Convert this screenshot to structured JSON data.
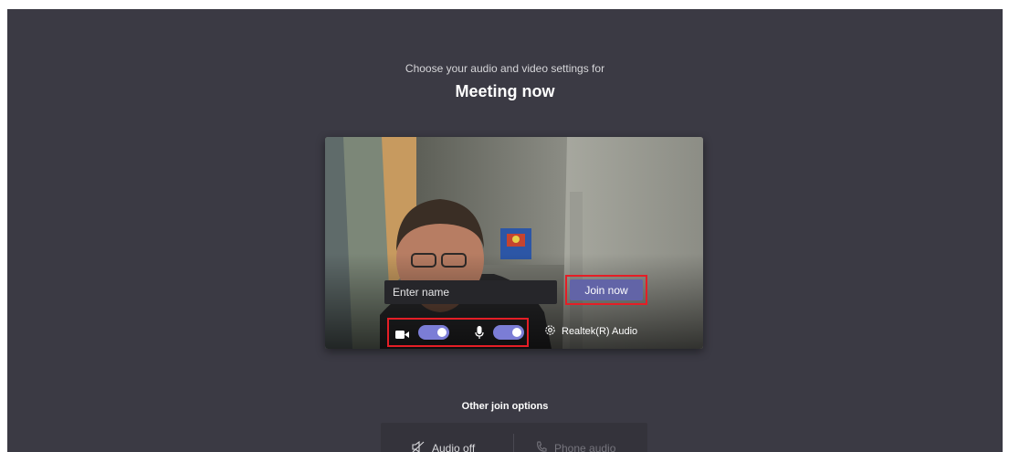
{
  "header": {
    "subtitle": "Choose your audio and video settings for",
    "title": "Meeting now"
  },
  "prejoin": {
    "name_placeholder": "Enter name",
    "name_value": "",
    "join_label": "Join now",
    "camera_on": true,
    "mic_on": true,
    "audio_device": "Realtek(R) Audio"
  },
  "other_options": {
    "title": "Other join options",
    "audio_off_label": "Audio off",
    "phone_audio_label": "Phone audio"
  },
  "colors": {
    "background": "#3b3a44",
    "accent": "#6264a7",
    "toggle_on": "#7b7dd6",
    "highlight": "#e41e26"
  },
  "icons": [
    "camera-icon",
    "microphone-icon",
    "gear-icon",
    "audio-off-icon",
    "phone-icon"
  ]
}
